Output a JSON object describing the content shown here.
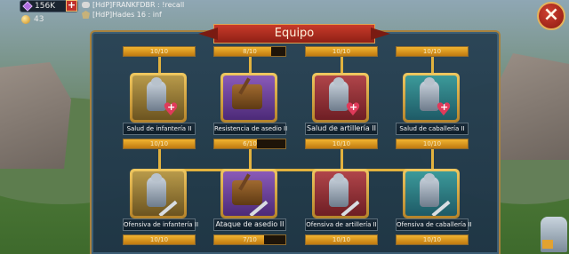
{
  "hud": {
    "gems": "156K",
    "gems_plus": "+",
    "gold": "43",
    "chat": [
      {
        "text": "[HdP]FRANKFDBR : !recall"
      },
      {
        "text": "[HdP]Hades 16 : inf"
      }
    ],
    "close": "×"
  },
  "panel": {
    "title": "Equipo",
    "top_row_bars": [
      {
        "text": "10/10",
        "progress": 1.0
      },
      {
        "text": "8/10",
        "progress": 0.8
      },
      {
        "text": "10/10",
        "progress": 1.0
      },
      {
        "text": "10/10",
        "progress": 1.0
      }
    ],
    "row1": [
      {
        "label": "Salud de infantería II",
        "bar": "10/10",
        "progress": 1.0,
        "color": "gold",
        "icon": "infantry-icon",
        "badge": "heart-plus-icon"
      },
      {
        "label": "Resistencia de asedio II",
        "bar": "6/10",
        "progress": 0.6,
        "color": "purple",
        "icon": "siege-icon",
        "badge": "shield-icon"
      },
      {
        "label": "Salud de artillería II",
        "bar": "10/10",
        "progress": 1.0,
        "color": "red",
        "icon": "archer-icon",
        "badge": "heart-plus-icon"
      },
      {
        "label": "Salud de caballería II",
        "bar": "10/10",
        "progress": 1.0,
        "color": "teal",
        "icon": "cavalry-icon",
        "badge": "heart-plus-icon"
      }
    ],
    "row2": [
      {
        "label": "Ofensiva de infantería II",
        "bar": "10/10",
        "progress": 1.0,
        "color": "gold",
        "icon": "infantry-icon",
        "badge": "sword-icon"
      },
      {
        "label": "Ataque de asedio II",
        "bar": "7/10",
        "progress": 0.7,
        "color": "purple",
        "icon": "siege-icon",
        "badge": "sword-icon"
      },
      {
        "label": "Ofensiva de artillería II",
        "bar": "10/10",
        "progress": 1.0,
        "color": "red",
        "icon": "archer-icon",
        "badge": "sword-icon"
      },
      {
        "label": "Ofensiva de caballería II",
        "bar": "10/10",
        "progress": 1.0,
        "color": "teal",
        "icon": "cavalry-icon",
        "badge": "sword-icon"
      }
    ]
  }
}
